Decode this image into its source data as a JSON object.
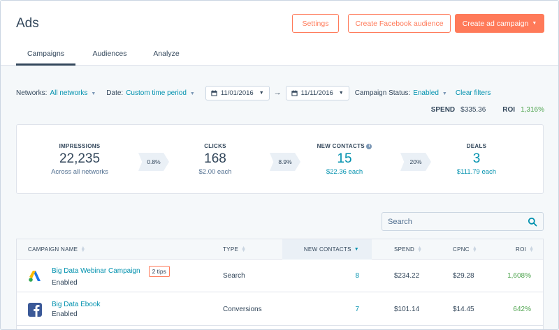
{
  "header": {
    "title": "Ads",
    "settings_label": "Settings",
    "facebook_label": "Create Facebook audience",
    "create_campaign_label": "Create ad campaign",
    "caret": "▼"
  },
  "tabs": [
    {
      "label": "Campaigns",
      "active": true
    },
    {
      "label": "Audiences",
      "active": false
    },
    {
      "label": "Analyze",
      "active": false
    }
  ],
  "filters": {
    "networks_label": "Networks:",
    "networks_value": "All networks",
    "date_label": "Date:",
    "date_value": "Custom time period",
    "start_date": "11/01/2016",
    "end_date": "11/11/2016",
    "arrow": "→",
    "status_label": "Campaign Status:",
    "status_value": "Enabled",
    "clear_label": "Clear filters"
  },
  "summary": {
    "spend_label": "SPEND",
    "spend_value": "$335.36",
    "roi_label": "ROI",
    "roi_value": "1,316%"
  },
  "funnel": {
    "impressions": {
      "label": "IMPRESSIONS",
      "value": "22,235",
      "sub": "Across all networks"
    },
    "rate1": "0.8%",
    "clicks": {
      "label": "CLICKS",
      "value": "168",
      "sub": "$2.00 each"
    },
    "rate2": "8.9%",
    "contacts": {
      "label": "NEW CONTACTS",
      "value": "15",
      "sub": "$22.36 each"
    },
    "rate3": "20%",
    "deals": {
      "label": "DEALS",
      "value": "3",
      "sub": "$111.79 each"
    }
  },
  "search": {
    "placeholder": "Search"
  },
  "table": {
    "columns": [
      "CAMPAIGN NAME",
      "TYPE",
      "NEW CONTACTS",
      "SPEND",
      "CPNC",
      "ROI"
    ],
    "rows": [
      {
        "network": "google-adwords",
        "name": "Big Data Webinar Campaign",
        "status": "Enabled",
        "tips": "2 tips",
        "type": "Search",
        "contacts": "8",
        "spend": "$234.22",
        "cpnc": "$29.28",
        "roi": "1,608%"
      },
      {
        "network": "facebook",
        "name": "Big Data Ebook",
        "status": "Enabled",
        "tips": "",
        "type": "Conversions",
        "contacts": "7",
        "spend": "$101.14",
        "cpnc": "$14.45",
        "roi": "642%"
      }
    ]
  },
  "colors": {
    "accent": "#ff7a59",
    "link": "#0091ae",
    "text": "#33475b",
    "positive": "#4fa44f",
    "background": "#f5f8fa"
  },
  "icons": {
    "calendar": "calendar-icon",
    "search": "search-icon",
    "info": "info-icon",
    "sort": "sort-icon"
  }
}
